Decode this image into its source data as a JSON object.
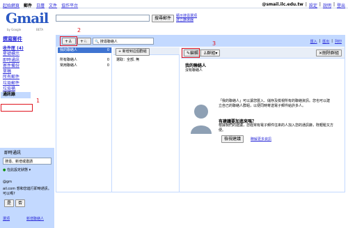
{
  "top_nav": [
    "起始網頁",
    "郵件",
    "日曆",
    "文件",
    "協作平台"
  ],
  "top_nav_current": "郵件",
  "top_links": {
    "email": "@smail.ilc.edu.tw",
    "settings": "設定",
    "help": "說明",
    "logout": "登出"
  },
  "logo": {
    "text": "Gmail",
    "by": "by Google",
    "beta": "BETA"
  },
  "search": {
    "mail_value": "",
    "button": "搜尋郵件",
    "options": "顯示搜尋選項",
    "create_filter": "建立篩選器"
  },
  "compose": "撰寫郵件",
  "nav": [
    "收件匣 (4)",
    "星號標示",
    "即時通訊",
    "寄件備份",
    "草稿",
    "所有郵件",
    "垃圾郵件",
    "垃圾桶",
    "通訊錄"
  ],
  "quick_contacts": {
    "header": "即時通訊",
    "search_placeholder": "搜尋、新增或邀請",
    "status": "在此設定狀態",
    "user": "@gm",
    "chat_question": "ail.com 想和您進行即時通訊。可以嗎?",
    "yes": "是",
    "no": "否",
    "options": "選項",
    "add_contact": "新增聯絡人"
  },
  "contacts_toolbar": {
    "search_placeholder": "搜尋聯絡人",
    "import": "匯入",
    "export": "匯出",
    "print": "列印"
  },
  "groups": [
    {
      "name": "我的聯絡人",
      "count": "0"
    },
    {
      "name": "所有聯絡人",
      "count": "0"
    },
    {
      "name": "常用聯絡人",
      "count": "0"
    }
  ],
  "list": {
    "add_to_group": "新增到這個群組",
    "select": "選取：全部, 無"
  },
  "detail": {
    "edit": "編輯",
    "groups": "群組",
    "delete_group": "刪除群組",
    "title": "我的聯絡人",
    "subtitle": "沒有聯絡人",
    "info": "「我的聯絡人」可以讓您匯入、儲存及檢視所有的聯絡資訊。您也可以建立自己的聯絡人群組，以便同時寄送電子郵件給許多人。",
    "q2": "有建議要加進來嗎？",
    "q2text": "根據我們的建議，您經常有電子郵件往來的人加入您的通訊錄，既輕鬆又方便。",
    "suggest_btn": "檢視建議",
    "more_info": "瞭解更多資訊"
  },
  "annotations": [
    "1",
    "2",
    "3"
  ],
  "colors": {
    "accent": "#c3d9ff",
    "annotation": "#e0141e",
    "link": "#2a2ad8"
  }
}
